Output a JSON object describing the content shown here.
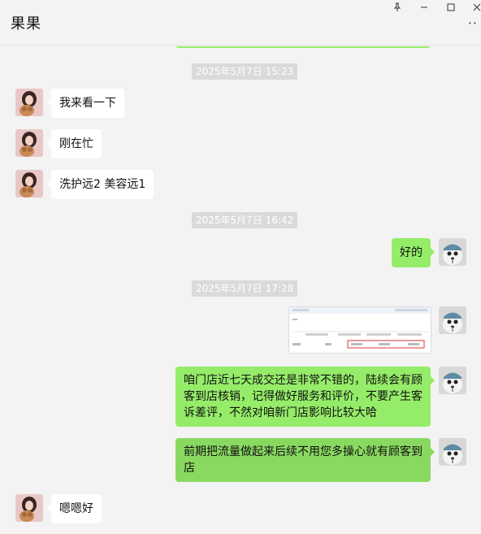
{
  "window": {
    "title": "果果",
    "controls": {
      "pin_icon": "pin-icon",
      "minimize_icon": "minimize-icon",
      "maximize_icon": "maximize-icon",
      "close_icon": "close-icon",
      "more_icon": "more-icon"
    }
  },
  "colors": {
    "sent_bubble": "#95ec69",
    "received_bubble": "#ffffff",
    "background": "#f3f3f3",
    "timestamp_bg": "#dadada"
  },
  "timestamps": [
    "2025年5月7日 15:23",
    "2025年5月7日 16:42",
    "2025年5月7日 17:28"
  ],
  "messages": [
    {
      "from": "contact",
      "text": "我来看一下"
    },
    {
      "from": "contact",
      "text": "刚在忙"
    },
    {
      "from": "contact",
      "text": "洗护远2 美容远1"
    },
    {
      "from": "me",
      "text": "好的"
    },
    {
      "from": "me",
      "type": "image",
      "text": ""
    },
    {
      "from": "me",
      "text": "咱门店近七天成交还是非常不错的，陆续会有顾客到店核销，记得做好服务和评价，不要产生客诉差评，不然对咱新门店影响比较大哈"
    },
    {
      "from": "me",
      "text": "前期把流量做起来后续不用您多操心就有顾客到店"
    },
    {
      "from": "contact",
      "text": "嗯嗯好"
    }
  ]
}
